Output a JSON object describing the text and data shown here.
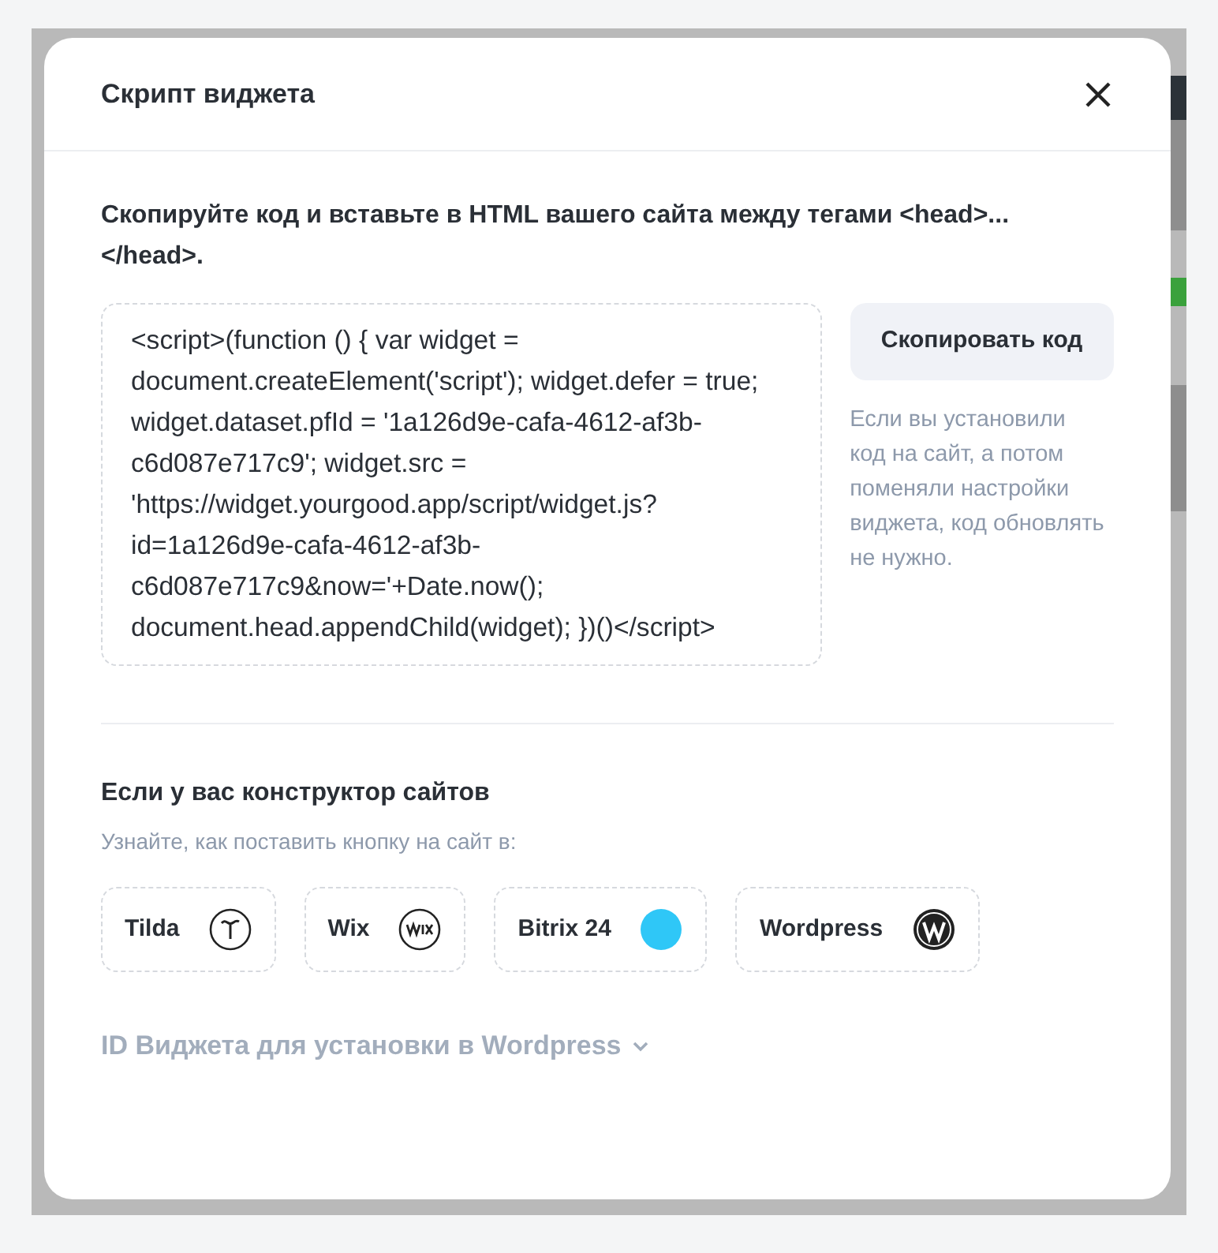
{
  "dialog": {
    "title": "Скрипт виджета",
    "instruction": "Скопируйте код и вставьте в HTML вашего сайта между тегами <head>...</head>.",
    "code": "<script>(function () { var widget = document.createElement('script'); widget.defer = true; widget.dataset.pfId = '1a126d9e-cafa-4612-af3b-c6d087e717c9'; widget.src = 'https://widget.yourgood.app/script/widget.js?id=1a126d9e-cafa-4612-af3b-c6d087e717c9&now='+Date.now(); document.head.appendChild(widget); })()</script>",
    "copy_button": "Скопировать код",
    "copy_hint": "Если вы установили код на сайт, а потом поменяли настройки виджета, код обновлять не нужно.",
    "builders_title": "Если у вас конструктор сайтов",
    "builders_hint": "Узнайте, как поставить кнопку на сайт в:",
    "builders": [
      {
        "label": "Tilda",
        "kind": "tilda"
      },
      {
        "label": "Wix",
        "kind": "wix"
      },
      {
        "label": "Bitrix 24",
        "kind": "bitrix"
      },
      {
        "label": "Wordpress",
        "kind": "wordpress"
      }
    ],
    "wordpress_id": {
      "label": "ID Виджета для установки в Wordpress",
      "expanded": false
    }
  }
}
